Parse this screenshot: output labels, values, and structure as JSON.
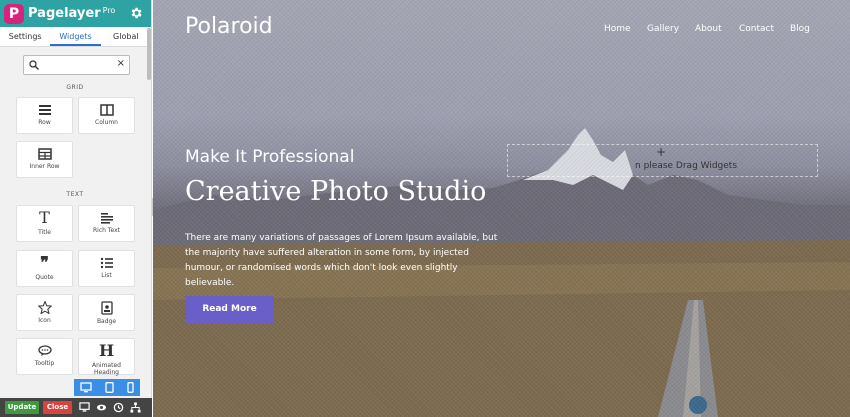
{
  "app": {
    "logo_letter": "P",
    "name": "Pagelayer",
    "badge": "Pro"
  },
  "tabs": [
    "Settings",
    "Widgets",
    "Global"
  ],
  "search": {
    "placeholder": "",
    "clear_glyph": "×"
  },
  "sections": {
    "grid": {
      "title": "GRID",
      "items": [
        "Row",
        "Column",
        "Inner Row"
      ]
    },
    "text": {
      "title": "TEXT",
      "items": [
        "Title",
        "Rich Text",
        "Quote",
        "List",
        "Icon",
        "Badge",
        "Tooltip",
        "Animated Heading"
      ]
    }
  },
  "actions": {
    "update": "Update",
    "close": "Close"
  },
  "site": {
    "title": "Polaroid",
    "nav": [
      "Home",
      "Gallery",
      "About",
      "Contact",
      "Blog"
    ],
    "tagline": "Make It Professional",
    "heading": "Creative Photo Studio",
    "description": "There are many variations of passages of Lorem Ipsum available, but the majority have suffered alteration in some form, by injected humour, or randomised words which don't look even slightly believable.",
    "button": "Read More"
  },
  "drop_zone": {
    "plus": "+",
    "text": "n please Drag Widgets"
  },
  "colors": {
    "header": "#2fa3a3",
    "accent_tab": "#2a6fc9",
    "update": "#3d9a3d",
    "close": "#d9433f",
    "cta": "#6a5fc9",
    "device_bar": "#3a8ee6"
  },
  "icons": [
    "gear-icon",
    "search-icon",
    "row-icon",
    "column-icon",
    "inner-row-icon",
    "title-icon",
    "rich-text-icon",
    "quote-icon",
    "list-icon",
    "star-icon",
    "badge-icon",
    "tooltip-icon",
    "heading-icon",
    "desktop-icon",
    "tablet-icon",
    "mobile-icon",
    "preview-eye-icon",
    "history-icon",
    "navigator-icon"
  ]
}
